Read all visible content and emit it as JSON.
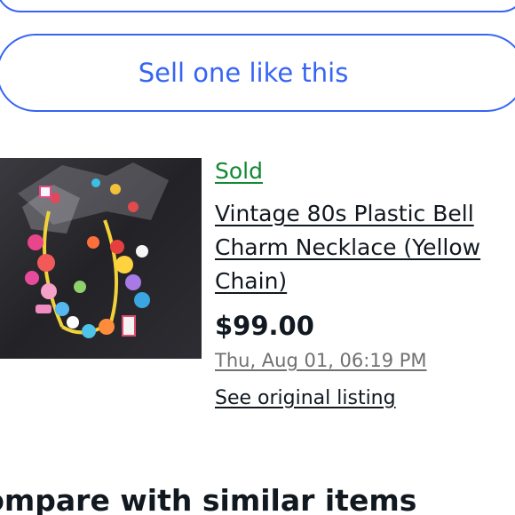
{
  "actions": {
    "sell_label": "Sell one like this"
  },
  "listing": {
    "status": "Sold",
    "title": "Vintage 80s Plastic Bell Charm Necklace (Yellow Chain)",
    "price": "$99.00",
    "date": "Thu, Aug 01, 06:19 PM",
    "link_label": "See original listing",
    "image_description": "photo of colorful plastic charms on a yellow chain"
  },
  "section": {
    "heading": "Compare with similar items"
  },
  "colors": {
    "accent": "#3665f3",
    "sold": "#118833",
    "text": "#111820",
    "muted": "#707070"
  }
}
